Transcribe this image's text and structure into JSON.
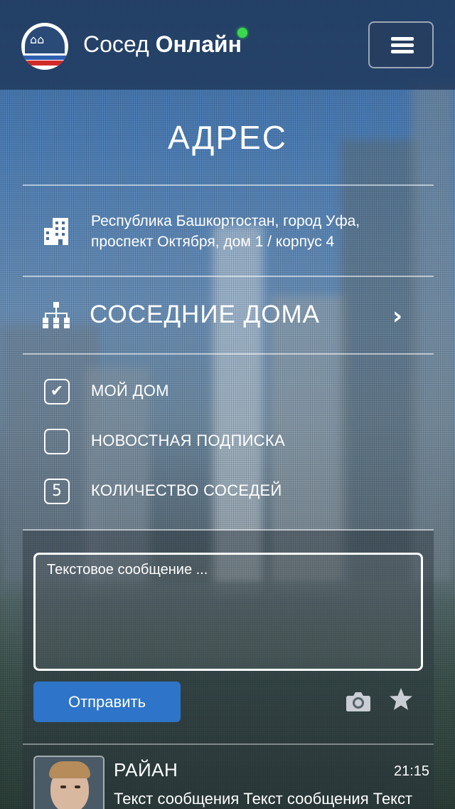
{
  "header": {
    "brand_light": "Сосед ",
    "brand_bold": "Онлайн",
    "online_status": "online",
    "menu_icon": "hamburger-icon"
  },
  "page": {
    "title": "АДРЕС"
  },
  "address": {
    "icon": "building-icon",
    "line1": "Республика Башкортостан, город Уфа,",
    "line2": "проспект Октября, дом 1 / корпус 4"
  },
  "neighbors": {
    "icon": "hierarchy-icon",
    "label": "СОСЕДНИЕ ДОМА",
    "chevron": "›"
  },
  "options": [
    {
      "label": "МОЙ ДОМ",
      "state": "checked",
      "glyph": "✔"
    },
    {
      "label": "НОВОСТНАЯ ПОДПИСКА",
      "state": "unchecked",
      "glyph": ""
    },
    {
      "label": "КОЛИЧЕСТВО СОСЕДЕЙ",
      "state": "count",
      "glyph": "5"
    }
  ],
  "composer": {
    "placeholder": "Текстовое сообщение ...",
    "send_label": "Отправить",
    "camera_icon": "camera-icon",
    "star_icon": "star-icon"
  },
  "messages": [
    {
      "author": "РАЙАН",
      "time": "21:15",
      "text": "Текст сообщения Текст сообщения Текст сообщения Текст сообщения"
    }
  ],
  "colors": {
    "header_bg": "#1e375a",
    "accent_button": "#2e74c8",
    "online_dot": "#38d94a"
  }
}
